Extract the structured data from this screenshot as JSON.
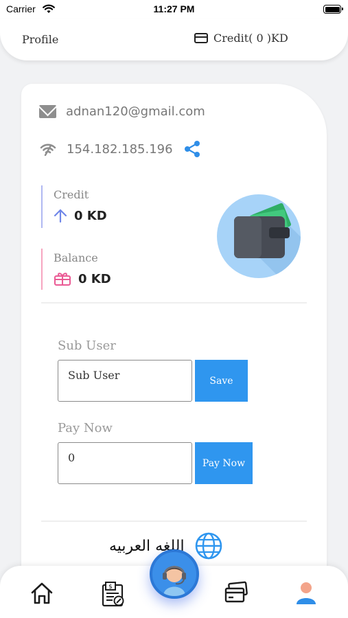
{
  "status_bar": {
    "carrier": "Carrier",
    "time": "11:27 PM"
  },
  "header": {
    "title": "Profile",
    "credit_label": "Credit( 0 )KD"
  },
  "account": {
    "email": "adnan120@gmail.com",
    "ip": "154.182.185.196"
  },
  "stats": {
    "credit_label": "Credit",
    "credit_value": "0 KD",
    "balance_label": "Balance",
    "balance_value": "0 KD"
  },
  "sub_user": {
    "label": "Sub User",
    "input_value": "Sub User",
    "button": "Save"
  },
  "pay_now": {
    "label": "Pay Now",
    "input_value": "0",
    "button": "Pay Now"
  },
  "language": {
    "label": "اللغه العربيه"
  },
  "tabbar": {
    "items": [
      "home-icon",
      "invoice-icon",
      "support-icon",
      "cards-icon",
      "profile-icon"
    ],
    "active": "profile-icon"
  },
  "colors": {
    "accent": "#2f96ef",
    "credit_line": "#b0b8f2",
    "balance_line": "#f6a5c0",
    "wallet_bg": "#a7d3f8"
  }
}
